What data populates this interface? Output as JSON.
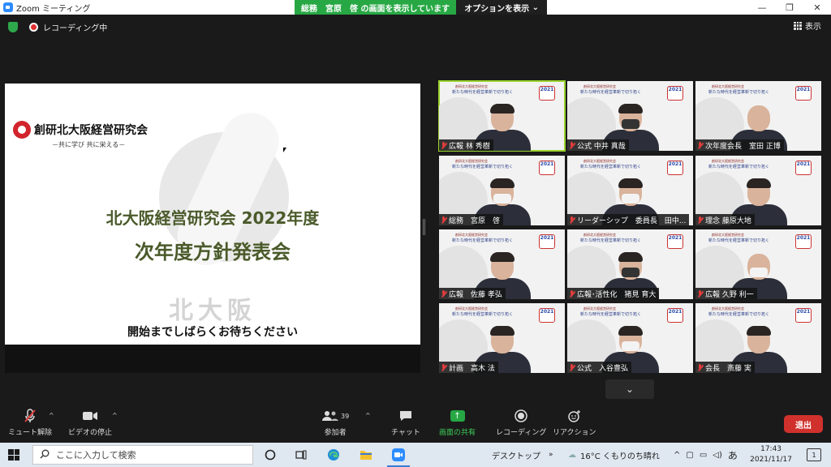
{
  "window": {
    "title": "Zoom ミーティング",
    "controls": [
      "—",
      "❐",
      "✕"
    ]
  },
  "share_banner": {
    "sharing_text": "総務　宮原　啓 の画面を表示しています",
    "options_label": "オプションを表示"
  },
  "status": {
    "recording": "レコーディング中",
    "view_label": "表示"
  },
  "slide": {
    "org_name": "創研北大阪経営研究会",
    "tagline": "－共に学び 共に栄える－",
    "title_line1": "北大阪経営研究会 2022年度",
    "title_line2": "次年度方針発表会",
    "place": "北大阪",
    "waiting": "開始までしばらくお待ちください"
  },
  "tile_header": {
    "org": "創研北大阪経営研究会",
    "theme": "新たな時代を経営革新で切り拓く",
    "badge": "2021"
  },
  "participants": [
    {
      "name": "広報 林 秀樹",
      "muted": true,
      "active": true
    },
    {
      "name": "公式 中井 真哉",
      "muted": true,
      "active": false
    },
    {
      "name": "次年度会長　室田 正博",
      "muted": true,
      "active": false
    },
    {
      "name": "総務　宮原　啓",
      "muted": true,
      "active": false
    },
    {
      "name": "リーダーシップ　委員長　田中...",
      "muted": true,
      "active": false
    },
    {
      "name": "理念 藤原大地",
      "muted": true,
      "active": false
    },
    {
      "name": "広報　佐藤 孝弘",
      "muted": true,
      "active": false
    },
    {
      "name": "広報･活性化　猪見 育大",
      "muted": true,
      "active": false
    },
    {
      "name": "広報 久野 利一",
      "muted": true,
      "active": false
    },
    {
      "name": "計画　高木 法",
      "muted": true,
      "active": false
    },
    {
      "name": "公式　入谷豊弘",
      "muted": true,
      "active": false
    },
    {
      "name": "会長　斎藤 実",
      "muted": true,
      "active": false
    }
  ],
  "toolbar": {
    "unmute": "ミュート解除",
    "stop_video": "ビデオの停止",
    "participants": "参加者",
    "participant_count": "39",
    "chat": "チャット",
    "share_screen": "画面の共有",
    "recording": "レコーディング",
    "reactions": "リアクション",
    "leave": "退出"
  },
  "taskbar": {
    "search_placeholder": "ここに入力して検索",
    "desktop_label": "デスクトップ",
    "weather": "16°C くもりのち晴れ",
    "ime": "あ",
    "time": "17:43",
    "date": "2021/11/17",
    "notification_count": "1"
  }
}
